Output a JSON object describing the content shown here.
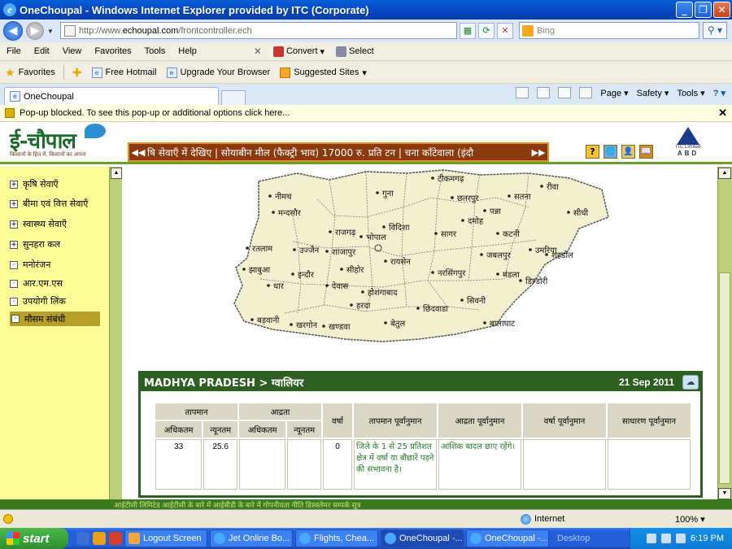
{
  "window": {
    "title": "OneChoupal - Windows Internet Explorer provided by ITC (Corporate)"
  },
  "address": {
    "url_prefix": "http://www.",
    "url_domain": "echoupal.com",
    "url_path": "/frontcontroller.ech",
    "search_placeholder": "Bing"
  },
  "menu": {
    "items": [
      "File",
      "Edit",
      "View",
      "Favorites",
      "Tools",
      "Help"
    ],
    "convert": "Convert",
    "select": "Select"
  },
  "favorites": {
    "label": "Favorites",
    "items": [
      "Free Hotmail",
      "Upgrade Your Browser",
      "Suggested Sites"
    ]
  },
  "tab": {
    "label": "OneChoupal"
  },
  "commandbar": {
    "page": "Page",
    "safety": "Safety",
    "tools": "Tools"
  },
  "infobar": {
    "text": "Pop-up blocked. To see this pop-up or additional options click here..."
  },
  "site": {
    "logo": "ई-चौपाल",
    "tagline": "किसानों के हित में, किसानों का अपना",
    "ticker": "षि सेवाएँ में देखिए | सोयाबीन मील (फैक्ट्री भाव) 17000 रु. प्रति टन | चना काँटेवाला (इंदौ",
    "itc_line1": "ITC Limited",
    "itc_line2": "ABD",
    "header_icons": [
      "?",
      "🌐",
      "👤",
      "📖"
    ]
  },
  "sidebar": {
    "items": [
      {
        "label": "कृषि सेवाएँ",
        "marker": "+"
      },
      {
        "label": "बीमा एवं वित्त सेवाएँ",
        "marker": "+"
      },
      {
        "label": "स्वास्थ्य सेवाएँ",
        "marker": "+"
      },
      {
        "label": "सुनहरा कल",
        "marker": "+"
      },
      {
        "label": "मनोरंजन",
        "marker": "·"
      },
      {
        "label": "आर.एम.एस",
        "marker": "·"
      },
      {
        "label": "उपयोगी लिंक",
        "marker": "·"
      },
      {
        "label": "मौसम संबंधी",
        "marker": "·"
      }
    ]
  },
  "map": {
    "districts": [
      "टीकमगढ़",
      "गुना",
      "छतरपुर",
      "सतना",
      "रीवा",
      "नीमच",
      "मन्दसौर",
      "पन्ना",
      "सीधी",
      "राजगढ़",
      "विदिशा",
      "सागर",
      "दमोह",
      "कटनी",
      "उमरिया",
      "रतलाम",
      "उज्जैन",
      "शाजापुर",
      "भोपाल",
      "जबलपुर",
      "शहडोल",
      "झाबुआ",
      "इन्दौर",
      "सीहोर",
      "रायसेन",
      "नरसिंगपुर",
      "मंडला",
      "डिण्डोरी",
      "धार",
      "देवास",
      "होशंगाबाद",
      "बड़वानी",
      "हरदा",
      "छिंदवाडा",
      "सिवनी",
      "खरगोन",
      "खण्डवा",
      "बेतुल",
      "बालाघाट"
    ]
  },
  "weather": {
    "location": "MADHYA PRADESH > ग्वालियर",
    "date": "21 Sep 2011",
    "headers": {
      "temp": "तापमान",
      "humidity": "आद्रता",
      "max": "अधिकतम",
      "min": "न्यूनतम",
      "rain": "वर्षा",
      "temp_forecast": "तापमान पूर्वानुमान",
      "humidity_forecast": "आद्रता पूर्वानुमान",
      "rain_forecast": "वर्षा पूर्वानुमान",
      "general_forecast": "साधारण पूर्वानुमान"
    },
    "row": {
      "temp_max": "33",
      "temp_min": "25.6",
      "hum_max": "",
      "hum_min": "",
      "rain": "0",
      "temp_forecast": "जिले के 1 से 25 प्रतिशत क्षेत्र में वर्षा या बौछारें पड़ने की संभावना है।",
      "humidity_forecast": "आंशिक बादल छाए रहेंगे।",
      "rain_forecast": "",
      "general_forecast": ""
    }
  },
  "footer_strip": "आईटीसी लिमिटेड     आईटीसी के बारे में     आईबीडी के बारे में     गोपनीयता नीति     डिस्क्लेमर     सम्पर्क सूत्र",
  "status": {
    "zone": "Internet",
    "zoom": "100%"
  },
  "taskbar": {
    "start": "start",
    "tasks": [
      "Logout Screen",
      "Jet Online Bo...",
      "Flights, Chea...",
      "OneChoupal -...",
      "OneChoupal -..."
    ],
    "desktop": "Desktop",
    "clock": "6:19 PM"
  },
  "colors": {
    "accent_green": "#2e5e20",
    "sidebar_yellow": "#ffff99",
    "ticker_brown": "#8b3a0e"
  }
}
